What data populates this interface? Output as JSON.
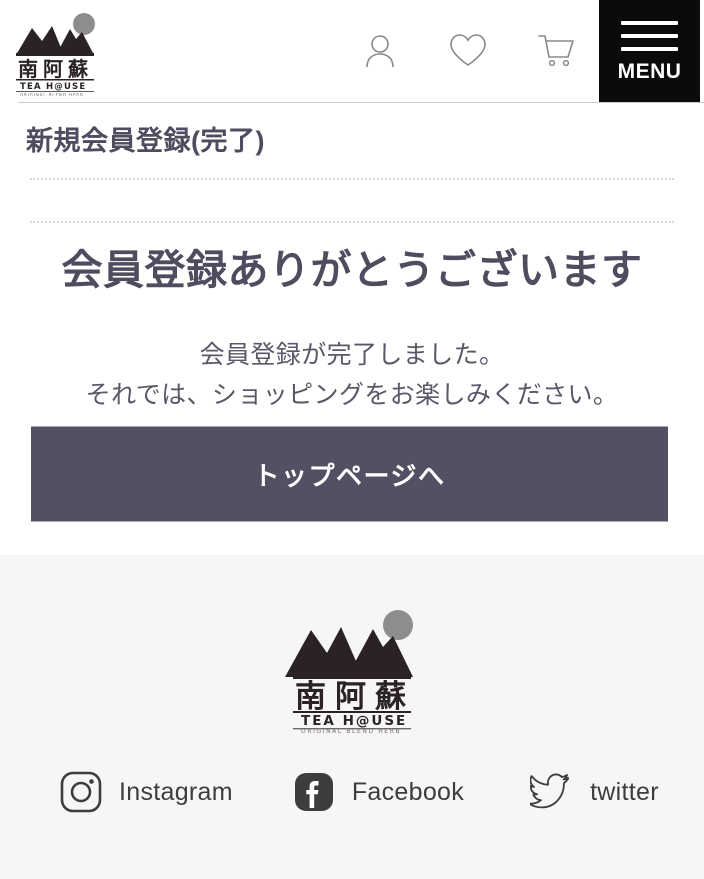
{
  "site": {
    "brand_name_ja": "南阿蘇",
    "brand_name_en": "TEA H@USE",
    "brand_tagline": "ORIGINAL BLEND HERB"
  },
  "header": {
    "logo_alt": "南阿蘇 TEA HOUSE",
    "icons": [
      {
        "name": "account-icon",
        "label": "account"
      },
      {
        "name": "favorites-icon",
        "label": "favorites"
      },
      {
        "name": "cart-icon",
        "label": "cart"
      }
    ],
    "menu_label": "MENU"
  },
  "page": {
    "title": "新規会員登録(完了)"
  },
  "main": {
    "heading": "会員登録ありがとうございます",
    "body_line1": "会員登録が完了しました。",
    "body_line2": "それでは、ショッピングをお楽しみください。",
    "primary_button": "トップページへ"
  },
  "footer": {
    "logo_name_ja": "南阿蘇",
    "logo_name_en": "TEA H@USE",
    "logo_tagline": "ORIGINAL BLEND HERB",
    "social": [
      {
        "icon": "instagram-icon",
        "label": "Instagram"
      },
      {
        "icon": "facebook-icon",
        "label": "Facebook"
      },
      {
        "icon": "twitter-icon",
        "label": "twitter"
      }
    ]
  },
  "colors": {
    "accent_dark": "#535064",
    "text_primary": "#4e4c5e",
    "menu_bg": "#0b0b0b",
    "footer_bg": "#f6f6f7",
    "logo_mountain": "#2b2323",
    "logo_circle": "#8d8d8d"
  }
}
